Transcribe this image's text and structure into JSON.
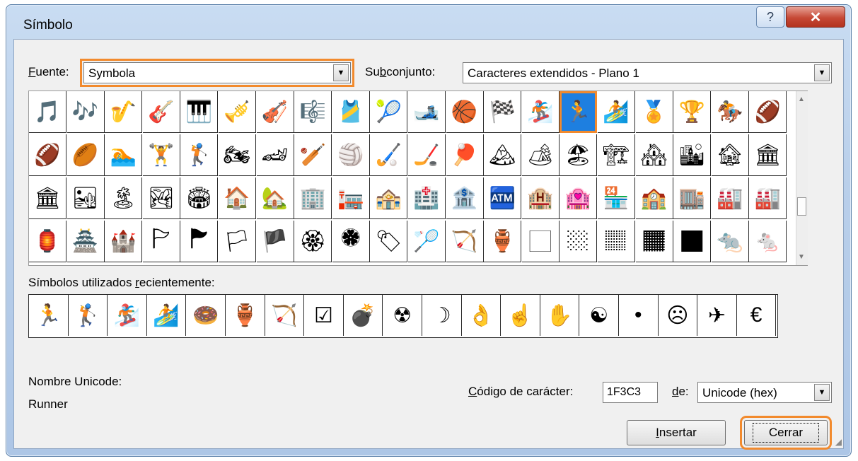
{
  "dialog": {
    "title": "Símbolo",
    "help_label": "?",
    "close_label": "✕"
  },
  "font": {
    "label_pre": "",
    "label_accel": "F",
    "label_post": "uente:",
    "value": "Symbola"
  },
  "subset": {
    "label_pre": "Su",
    "label_accel": "b",
    "label_post": "conjunto:",
    "value": "Caracteres extendidos - Plano 1"
  },
  "symbols_grid": {
    "rows": [
      [
        "🎵",
        "🎶",
        "🎷",
        "🎸",
        "🎹",
        "🎺",
        "🎻",
        "🎼",
        "🎽",
        "🎾",
        "🎿",
        "🏀",
        "🏁",
        "🏂",
        "🏃",
        "🏄",
        "🏅",
        "🏆",
        "🏇",
        "🏈"
      ],
      [
        "🏈",
        "🏉",
        "🏊",
        "🏋",
        "🏌",
        "🏍",
        "🏎",
        "🏏",
        "🏐",
        "🏑",
        "🏒",
        "🏓",
        "🏔",
        "🏕",
        "🏖",
        "🏗",
        "🏘",
        "🏙",
        "🏚",
        "🏛"
      ],
      [
        "🏛",
        "🏜",
        "🏝",
        "🏞",
        "🏟",
        "🏠",
        "🏡",
        "🏢",
        "🏣",
        "🏤",
        "🏥",
        "🏦",
        "🏧",
        "🏨",
        "🏩",
        "🏪",
        "🏫",
        "🏬",
        "🏭",
        "🏭"
      ],
      [
        "🏮",
        "🏯",
        "🏰",
        "🏱",
        "🏲",
        "🏳",
        "🏴",
        "🏵",
        "🏶",
        "🏷",
        "🏸",
        "🏹",
        "🏺",
        "🏻",
        "🏼",
        "🏽",
        "🏾",
        "🏿",
        "🐀",
        "🐁"
      ]
    ],
    "selected_row": 0,
    "selected_col": 14
  },
  "recent": {
    "label_pre": "Símbolos utilizados ",
    "label_accel": "r",
    "label_post": "ecientemente:",
    "symbols": [
      "🏃",
      "🏌",
      "🏂",
      "🏄",
      "🍩",
      "🏺",
      "🏹",
      "☑",
      "💣",
      "☢",
      "☽",
      "👌",
      "☝",
      "✋",
      "☯",
      "•",
      "☹",
      "✈",
      "€"
    ]
  },
  "unicode": {
    "name_label": "Nombre Unicode:",
    "name_value": "Runner"
  },
  "code": {
    "label_pre": "",
    "label_accel": "C",
    "label_post": "ódigo de carácter:",
    "value": "1F3C3",
    "from_accel": "d",
    "from_post": "e:",
    "from_value": "Unicode (hex)"
  },
  "buttons": {
    "insert_accel": "I",
    "insert_post": "nsertar",
    "close_label": "Cerrar"
  },
  "colors": {
    "highlight": "#f28a2d",
    "selection": "#1e7fe0"
  }
}
